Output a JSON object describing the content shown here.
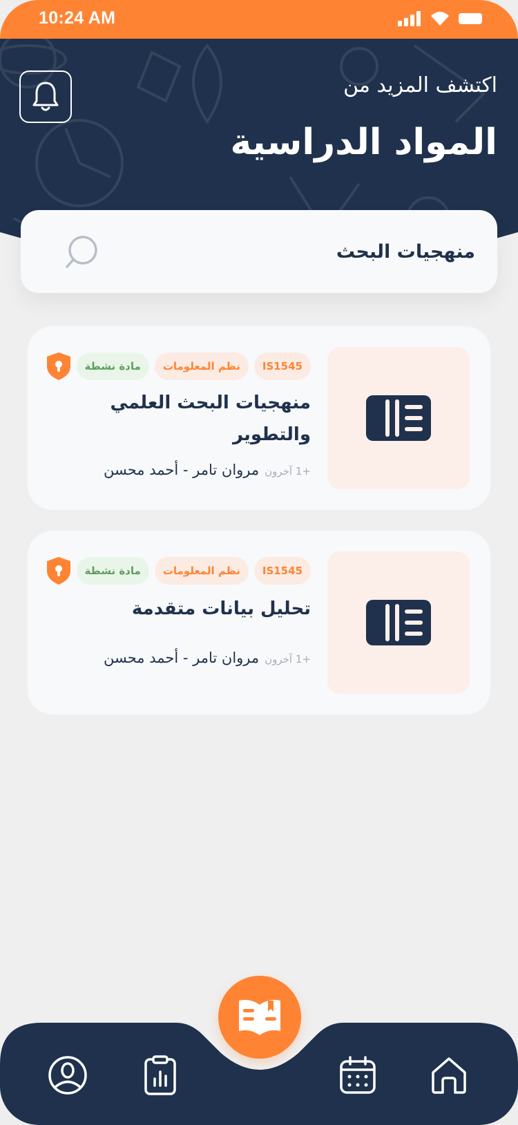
{
  "status_bar": {
    "time": "10:24 AM"
  },
  "header": {
    "subtitle": "اكتشف المزيد من",
    "title": "المواد الدراسية"
  },
  "search": {
    "value": "منهجيات البحث"
  },
  "courses": [
    {
      "code": "IS1545",
      "department": "نظم المعلومات",
      "status": "مادة نشطة",
      "title": "منهجيات البحث العلمي والتطوير",
      "authors": "مروان تامر - أحمد محسن",
      "more": "+1 آخرون"
    },
    {
      "code": "IS1545",
      "department": "نظم المعلومات",
      "status": "مادة نشطة",
      "title": "تحليل بيانات متقدمة",
      "authors": "مروان تامر - أحمد محسن",
      "more": "+1 آخرون"
    }
  ],
  "colors": {
    "accent": "#fe8434",
    "navy": "#1f314c",
    "status_green": "#5f9e5f",
    "thumb_bg": "#fcefe9"
  },
  "nav": {
    "items": [
      "profile-icon",
      "report-icon",
      "courses-icon",
      "calendar-icon",
      "home-icon"
    ]
  }
}
